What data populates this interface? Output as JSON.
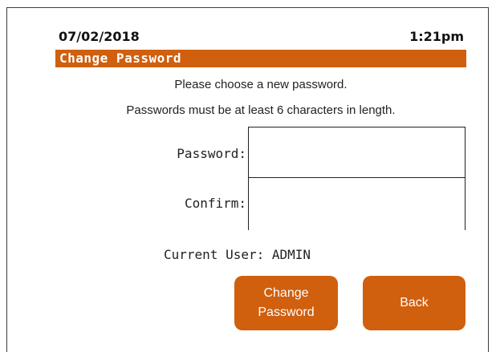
{
  "header": {
    "date": "07/02/2018",
    "time": "1:21pm"
  },
  "screen": {
    "title": "Change Password",
    "instruction_line1": "Please choose a new password.",
    "instruction_line2": "Passwords must be at least 6 characters in length."
  },
  "form": {
    "password_label": "Password:",
    "password_value": "",
    "confirm_label": "Confirm:",
    "confirm_value": ""
  },
  "status": {
    "current_user": "Current User: ADMIN"
  },
  "buttons": {
    "change_line1": "Change",
    "change_line2": "Password",
    "back_label": "Back"
  },
  "colors": {
    "accent": "#d05f0e",
    "text": "#222222",
    "background": "#ffffff"
  }
}
